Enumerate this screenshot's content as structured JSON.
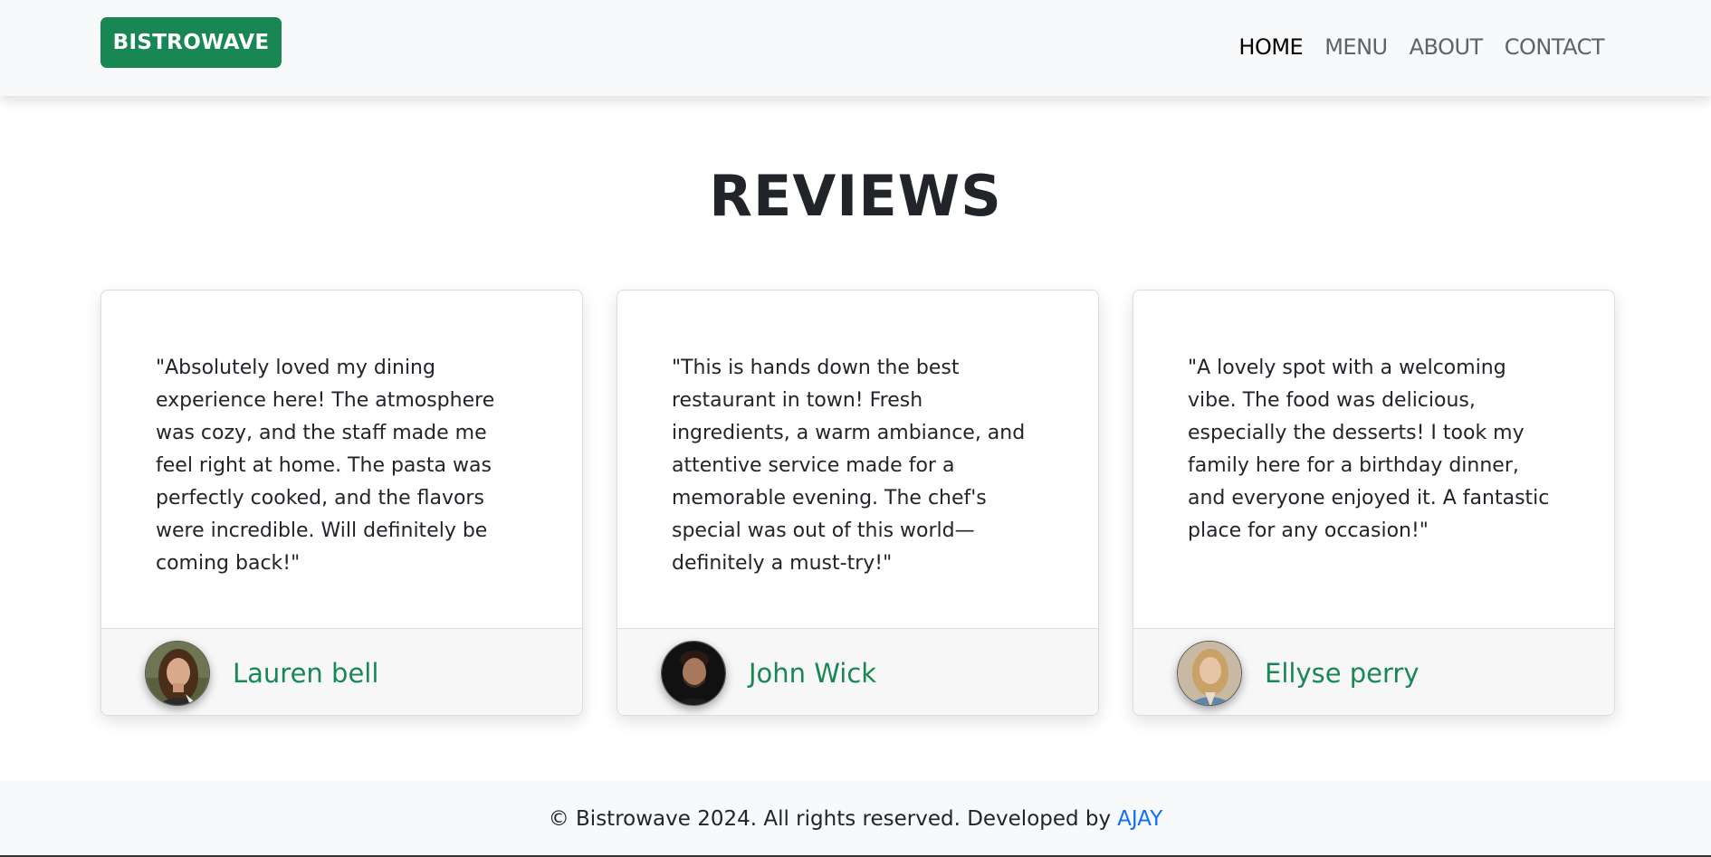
{
  "nav": {
    "brand": "BISTROWAVE",
    "links": [
      "HOME",
      "MENU",
      "ABOUT",
      "CONTACT"
    ],
    "active": "HOME"
  },
  "section": {
    "title": "REVIEWS"
  },
  "reviews": [
    {
      "quote": "\"Absolutely loved my dining experience here! The atmosphere was cozy, and the staff made me feel right at home. The pasta was perfectly cooked, and the flavors were incredible. Will definitely be coming back!\"",
      "name": "Lauren bell"
    },
    {
      "quote": "\"This is hands down the best restaurant in town! Fresh ingredients, a warm ambiance, and attentive service made for a memorable evening. The chef's special was out of this world—definitely a must-try!\"",
      "name": "John Wick"
    },
    {
      "quote": "\"A lovely spot with a welcoming vibe. The food was delicious, especially the desserts! I took my family here for a birthday dinner, and everyone enjoyed it. A fantastic place for any occasion!\"",
      "name": "Ellyse perry"
    }
  ],
  "footer": {
    "text": "© Bistrowave 2024. All rights reserved. Developed by",
    "link": "AJAY"
  },
  "colors": {
    "brand": "#198754",
    "link": "#0d6efd"
  }
}
